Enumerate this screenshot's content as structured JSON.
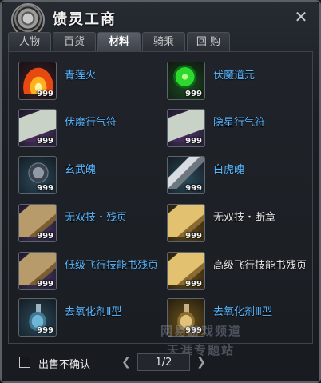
{
  "window": {
    "title": "馈灵工商",
    "close_icon": "tools-close-icon"
  },
  "tabs": [
    {
      "label": "人物",
      "active": false
    },
    {
      "label": "百货",
      "active": false
    },
    {
      "label": "材料",
      "active": true
    },
    {
      "label": "骑乘",
      "active": false
    },
    {
      "label": "回 购",
      "active": false
    }
  ],
  "items": [
    {
      "name": "青莲火",
      "qty": "999",
      "icon": "fire-icon"
    },
    {
      "name": "伏魔道元",
      "qty": "999",
      "icon": "green-orb-icon"
    },
    {
      "name": "伏魔行气符",
      "qty": "999",
      "icon": "talisman-icon"
    },
    {
      "name": "隐星行气符",
      "qty": "999",
      "icon": "talisman-icon"
    },
    {
      "name": "玄武魄",
      "qty": "999",
      "icon": "turtle-shell-icon"
    },
    {
      "name": "白虎魄",
      "qty": "999",
      "icon": "claw-icon"
    },
    {
      "name": "无双技・残页",
      "qty": "999",
      "icon": "parchment-icon"
    },
    {
      "name": "无双技・断章",
      "qty": "999",
      "icon": "gold-parchment-icon"
    },
    {
      "name": "低级飞行技能书残页",
      "qty": "999",
      "icon": "parchment-icon"
    },
    {
      "name": "高级飞行技能书残页",
      "qty": "999",
      "icon": "gold-parchment-icon"
    },
    {
      "name": "去氧化剂Ⅱ型",
      "qty": "999",
      "icon": "flask-icon"
    },
    {
      "name": "去氧化剂Ⅲ型",
      "qty": "999",
      "icon": "gold-flask-icon"
    }
  ],
  "watermark": {
    "line1": "网易游戏频道",
    "line2": "天涯专题站"
  },
  "footer": {
    "confirm_label": "出售不确认",
    "page": "1/2",
    "prev_icon": "arrow-left-icon",
    "next_icon": "arrow-right-icon"
  }
}
